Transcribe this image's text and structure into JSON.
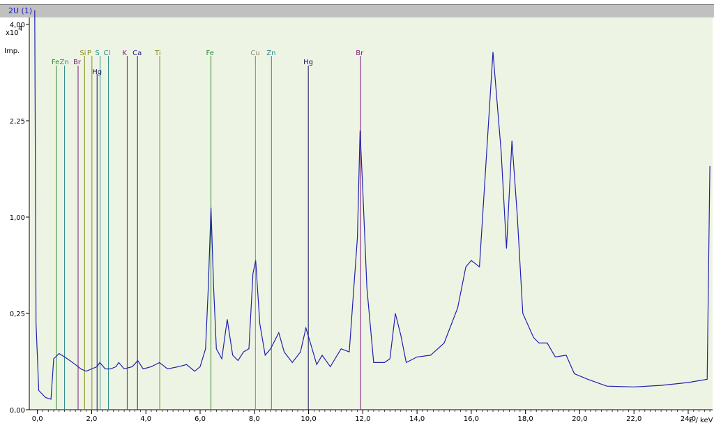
{
  "window": {
    "title": "2U (1)"
  },
  "colors": {
    "plot_bg": "#eef4e4",
    "spectrum": "#1f1fb0",
    "frame": "#000000"
  },
  "chart_data": {
    "type": "line",
    "title": "",
    "xlabel": "E / keV",
    "ylabel": "Imp.",
    "y_multiplier": "x10",
    "y_exponent": "4",
    "xlim": [
      -0.3,
      24.9
    ],
    "x_ticks": [
      {
        "v": 0,
        "label": "0,0"
      },
      {
        "v": 2,
        "label": "2,0"
      },
      {
        "v": 4,
        "label": "4,0"
      },
      {
        "v": 6,
        "label": "6,0"
      },
      {
        "v": 8,
        "label": "8,0"
      },
      {
        "v": 10,
        "label": "10,0"
      },
      {
        "v": 12,
        "label": "12,0"
      },
      {
        "v": 14,
        "label": "14,0"
      },
      {
        "v": 16,
        "label": "16,0"
      },
      {
        "v": 18,
        "label": "18,0"
      },
      {
        "v": 20,
        "label": "20,0"
      },
      {
        "v": 22,
        "label": "22,0"
      },
      {
        "v": 24,
        "label": "24,0"
      }
    ],
    "y_ticks": [
      {
        "v": 0.0,
        "label": "0,00"
      },
      {
        "v": 0.25,
        "label": "0,25"
      },
      {
        "v": 1.0,
        "label": "1,00"
      },
      {
        "v": 2.25,
        "label": "2,25"
      },
      {
        "v": 4.0,
        "label": "4,00"
      }
    ],
    "y_scale": "sqrt",
    "series": [
      {
        "points": [
          [
            -0.1,
            4.3
          ],
          [
            -0.05,
            0.2
          ],
          [
            0.05,
            0.01
          ],
          [
            0.3,
            0.004
          ],
          [
            0.5,
            0.003
          ],
          [
            0.6,
            0.07
          ],
          [
            0.8,
            0.085
          ],
          [
            1.0,
            0.075
          ],
          [
            1.2,
            0.065
          ],
          [
            1.4,
            0.055
          ],
          [
            1.6,
            0.045
          ],
          [
            1.8,
            0.04
          ],
          [
            2.0,
            0.045
          ],
          [
            2.2,
            0.05
          ],
          [
            2.3,
            0.06
          ],
          [
            2.5,
            0.045
          ],
          [
            2.7,
            0.045
          ],
          [
            2.9,
            0.05
          ],
          [
            3.0,
            0.06
          ],
          [
            3.2,
            0.045
          ],
          [
            3.5,
            0.05
          ],
          [
            3.7,
            0.065
          ],
          [
            3.9,
            0.045
          ],
          [
            4.2,
            0.05
          ],
          [
            4.5,
            0.06
          ],
          [
            4.8,
            0.045
          ],
          [
            5.2,
            0.05
          ],
          [
            5.5,
            0.055
          ],
          [
            5.8,
            0.04
          ],
          [
            6.0,
            0.05
          ],
          [
            6.2,
            0.1
          ],
          [
            6.3,
            0.4
          ],
          [
            6.4,
            1.1
          ],
          [
            6.5,
            0.4
          ],
          [
            6.6,
            0.1
          ],
          [
            6.8,
            0.07
          ],
          [
            7.0,
            0.22
          ],
          [
            7.2,
            0.08
          ],
          [
            7.4,
            0.065
          ],
          [
            7.6,
            0.09
          ],
          [
            7.8,
            0.1
          ],
          [
            7.95,
            0.5
          ],
          [
            8.05,
            0.6
          ],
          [
            8.2,
            0.2
          ],
          [
            8.4,
            0.08
          ],
          [
            8.6,
            0.1
          ],
          [
            8.9,
            0.16
          ],
          [
            9.1,
            0.09
          ],
          [
            9.4,
            0.06
          ],
          [
            9.7,
            0.09
          ],
          [
            9.9,
            0.18
          ],
          [
            10.1,
            0.11
          ],
          [
            10.3,
            0.055
          ],
          [
            10.5,
            0.08
          ],
          [
            10.8,
            0.05
          ],
          [
            11.2,
            0.1
          ],
          [
            11.5,
            0.09
          ],
          [
            11.8,
            0.8
          ],
          [
            11.9,
            2.1
          ],
          [
            12.0,
            1.3
          ],
          [
            12.15,
            0.4
          ],
          [
            12.4,
            0.06
          ],
          [
            12.8,
            0.06
          ],
          [
            13.0,
            0.07
          ],
          [
            13.2,
            0.25
          ],
          [
            13.4,
            0.15
          ],
          [
            13.6,
            0.06
          ],
          [
            14.0,
            0.075
          ],
          [
            14.5,
            0.08
          ],
          [
            15.0,
            0.12
          ],
          [
            15.5,
            0.28
          ],
          [
            15.8,
            0.55
          ],
          [
            16.0,
            0.6
          ],
          [
            16.3,
            0.55
          ],
          [
            16.5,
            1.4
          ],
          [
            16.8,
            3.45
          ],
          [
            17.1,
            1.8
          ],
          [
            17.3,
            0.7
          ],
          [
            17.5,
            1.95
          ],
          [
            17.7,
            1.0
          ],
          [
            17.9,
            0.25
          ],
          [
            18.3,
            0.14
          ],
          [
            18.5,
            0.12
          ],
          [
            18.8,
            0.12
          ],
          [
            19.1,
            0.075
          ],
          [
            19.5,
            0.08
          ],
          [
            19.8,
            0.035
          ],
          [
            20.3,
            0.025
          ],
          [
            21.0,
            0.015
          ],
          [
            22.0,
            0.014
          ],
          [
            23.0,
            0.016
          ],
          [
            24.0,
            0.02
          ],
          [
            24.7,
            0.025
          ],
          [
            24.8,
            1.6
          ]
        ]
      }
    ],
    "element_lines": [
      {
        "element": "Fe",
        "energy": 0.7,
        "color": "#2a8a2a",
        "label_row": 2
      },
      {
        "element": "Zn",
        "energy": 1.0,
        "color": "#2a8a8a",
        "label_row": 2
      },
      {
        "element": "Br",
        "energy": 1.5,
        "color": "#7a1a7a",
        "label_row": 2
      },
      {
        "element": "Si",
        "energy": 1.74,
        "color": "#8a8a1a",
        "label_row": 1
      },
      {
        "element": "P",
        "energy": 2.01,
        "color": "#8a8a1a",
        "label_row": 1
      },
      {
        "element": "Hg",
        "energy": 2.2,
        "color": "#101060",
        "label_row": 3
      },
      {
        "element": "S",
        "energy": 2.31,
        "color": "#2a8a8a",
        "label_row": 1
      },
      {
        "element": "Cl",
        "energy": 2.62,
        "color": "#2a8a8a",
        "label_row": 1
      },
      {
        "element": "K",
        "energy": 3.31,
        "color": "#7a1a7a",
        "label_row": 1
      },
      {
        "element": "Ca",
        "energy": 3.69,
        "color": "#1a1a8a",
        "label_row": 1
      },
      {
        "element": "Ti",
        "energy": 4.51,
        "color": "#8a8a1a",
        "label_row": 1
      },
      {
        "element": "Fe",
        "energy": 6.4,
        "color": "#2a8a2a",
        "label_row": 1
      },
      {
        "element": "Cu",
        "energy": 8.04,
        "color": "#8a8a6a",
        "label_row": 1
      },
      {
        "element": "Zn",
        "energy": 8.63,
        "color": "#2a8a8a",
        "label_row": 1
      },
      {
        "element": "Hg",
        "energy": 9.99,
        "color": "#101060",
        "label_row": 2
      },
      {
        "element": "Br",
        "energy": 11.92,
        "color": "#7a1a7a",
        "label_row": 1
      }
    ]
  }
}
